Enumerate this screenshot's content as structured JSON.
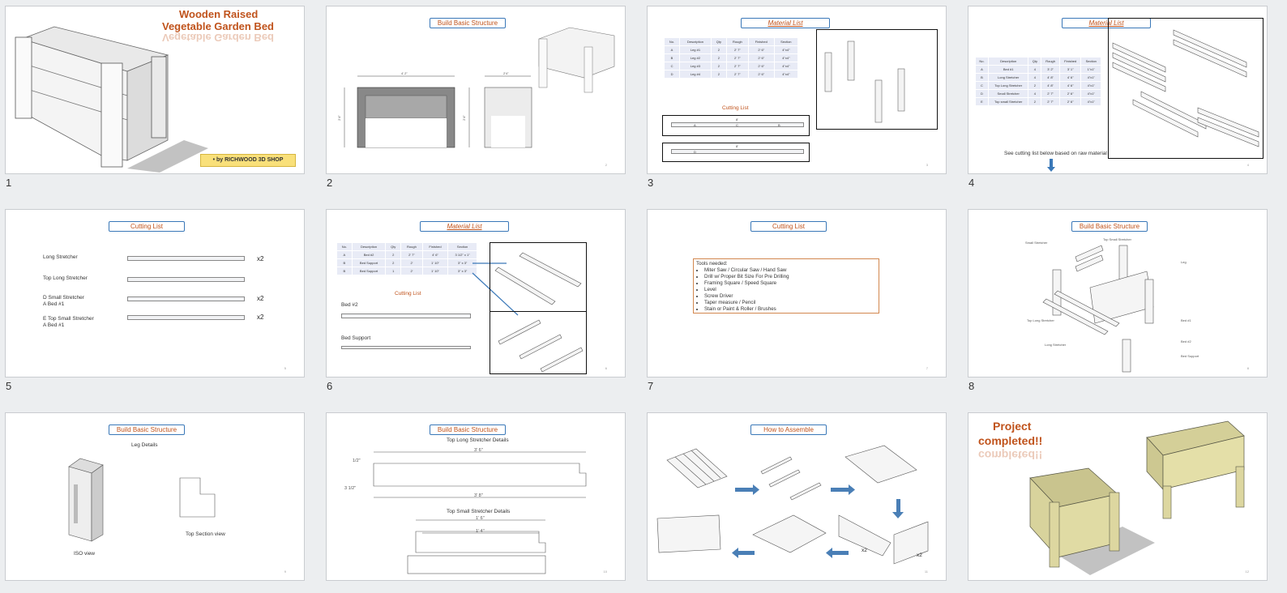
{
  "slides": [
    {
      "number": "1",
      "title_line1": "Wooden Raised",
      "title_line2": "Vegetable Garden Bed",
      "reflection": "Vegetable Garden Bed",
      "byline": "by RICHWOOD 3D SHOP"
    },
    {
      "number": "2",
      "title": "Build Basic Structure",
      "dims": {
        "front_width": "4' 2\"",
        "side_width": "2'4\"",
        "front_height": "2'4\"",
        "side_height": "2'4\""
      },
      "page": "2"
    },
    {
      "number": "3",
      "title": "Material List",
      "table_headers": [
        "No.",
        "Description",
        "Qty",
        "Rough",
        "Finished",
        "Section"
      ],
      "table_subheaders": [
        "L",
        "L"
      ],
      "rows": [
        [
          "A",
          "Leg #1",
          "2",
          "2' 7\"",
          "2' 6\"",
          "4\"x4\""
        ],
        [
          "B",
          "Leg #2",
          "2",
          "2' 7\"",
          "2' 6\"",
          "4\"x4\""
        ],
        [
          "C",
          "Leg #3",
          "2",
          "2' 7\"",
          "2' 6\"",
          "4\"x4\""
        ],
        [
          "D",
          "Leg #4",
          "2",
          "2' 7\"",
          "2' 6\"",
          "4\"x4\""
        ]
      ],
      "cutting_title": "Cutting List",
      "bar1_len": "8'",
      "bar2_len": "8'",
      "bar1_labels": [
        "A",
        "C",
        "B"
      ],
      "bar2_labels": [
        "D"
      ],
      "page": "3"
    },
    {
      "number": "4",
      "title": "Material List",
      "table_headers": [
        "No.",
        "Description",
        "Qty",
        "Rough",
        "Finished",
        "Section"
      ],
      "rows": [
        [
          "A",
          "Bed #1",
          "4",
          "3' 2\"",
          "3' 1\"",
          "1\"x1\""
        ],
        [
          "B",
          "Long Stretcher",
          "4",
          "4' 8\"",
          "4' 6\"",
          "4\"x1\""
        ],
        [
          "C",
          "Top Long Stretcher",
          "2",
          "4' 8\"",
          "4' 6\"",
          "4\"x1\""
        ],
        [
          "D",
          "Small Stretcher",
          "4",
          "2' 7\"",
          "2' 6\"",
          "4\"x1\""
        ],
        [
          "E",
          "Top small Stretcher",
          "2",
          "2' 7\"",
          "2' 6\"",
          "4\"x1\""
        ]
      ],
      "note": "See cutting list below based on raw material",
      "page": "4"
    },
    {
      "number": "5",
      "title": "Cutting List",
      "rows": [
        {
          "label1": "Long Stretcher",
          "label2": "",
          "x": "x2"
        },
        {
          "label1": "Top Long Stretcher",
          "label2": "",
          "x": ""
        },
        {
          "label1": "D Small Stretcher",
          "label2": "A Bed #1",
          "x": "x2"
        },
        {
          "label1": "E Top Small Stretcher",
          "label2": "A Bed #1",
          "x": "x2"
        }
      ],
      "page": "5"
    },
    {
      "number": "6",
      "title": "Material List",
      "table_headers": [
        "No.",
        "Description",
        "Qty",
        "Rough",
        "Finished",
        "Section"
      ],
      "rows": [
        [
          "A",
          "Bed #2",
          "2",
          "2' 7\"",
          "4' 6\"",
          "3 1/2\" x 1\""
        ],
        [
          "B",
          "Bed Support",
          "2",
          "2'",
          "1' 10\"",
          "3\" x 3\""
        ],
        [
          "B",
          "Bed Support",
          "1",
          "2'",
          "1' 10\"",
          "3\" x 3\""
        ]
      ],
      "cutting_title": "Cutting List",
      "label_a": "Bed #2",
      "label_b": "Bed Support",
      "page": "6"
    },
    {
      "number": "7",
      "title": "Cutting List",
      "tools_heading": "Tools needed:",
      "tools": [
        "Miter Saw / Circular Saw / Hand Saw",
        "Drill w/ Proper Bit Size For Pre Drilling",
        "Framing Square  / Speed Square",
        "Level",
        "Screw Driver",
        "Taper measure / Pencil",
        "Stain or Paint & Roller / Brushes"
      ],
      "page": "7"
    },
    {
      "number": "8",
      "title": "Build Basic Structure",
      "callouts": [
        "Small Stretcher",
        "Top Small Stretcher",
        "Leg",
        "Top Long Stretcher",
        "Long Stretcher",
        "Bed #1",
        "Bed #2",
        "Bed Support"
      ],
      "page": "8"
    },
    {
      "number": "9",
      "title": "Build Basic Structure",
      "label_top": "Leg Details",
      "label_iso": "ISO view",
      "label_section": "Top Section view",
      "page": "9"
    },
    {
      "number": "10",
      "title": "Build Basic Structure",
      "label_top": "Top Long Stretcher Details",
      "label_bottom": "Top Small Stretcher Details",
      "dim_a": "3' 6\"",
      "dim_b": "3' 8\"",
      "dim_c": "1' 6\"",
      "dim_d": "1' 4\"",
      "dim_e": "3 1/2\"",
      "dim_f": "1/2\"",
      "page": "10"
    },
    {
      "number": "11",
      "title": "How to Assemble",
      "x2_a": "x2",
      "x2_b": "x2",
      "page": "11"
    },
    {
      "number": "12",
      "title_line1": "Project",
      "title_line2": "completed!!",
      "reflection": "completed!!",
      "page": "12"
    }
  ]
}
